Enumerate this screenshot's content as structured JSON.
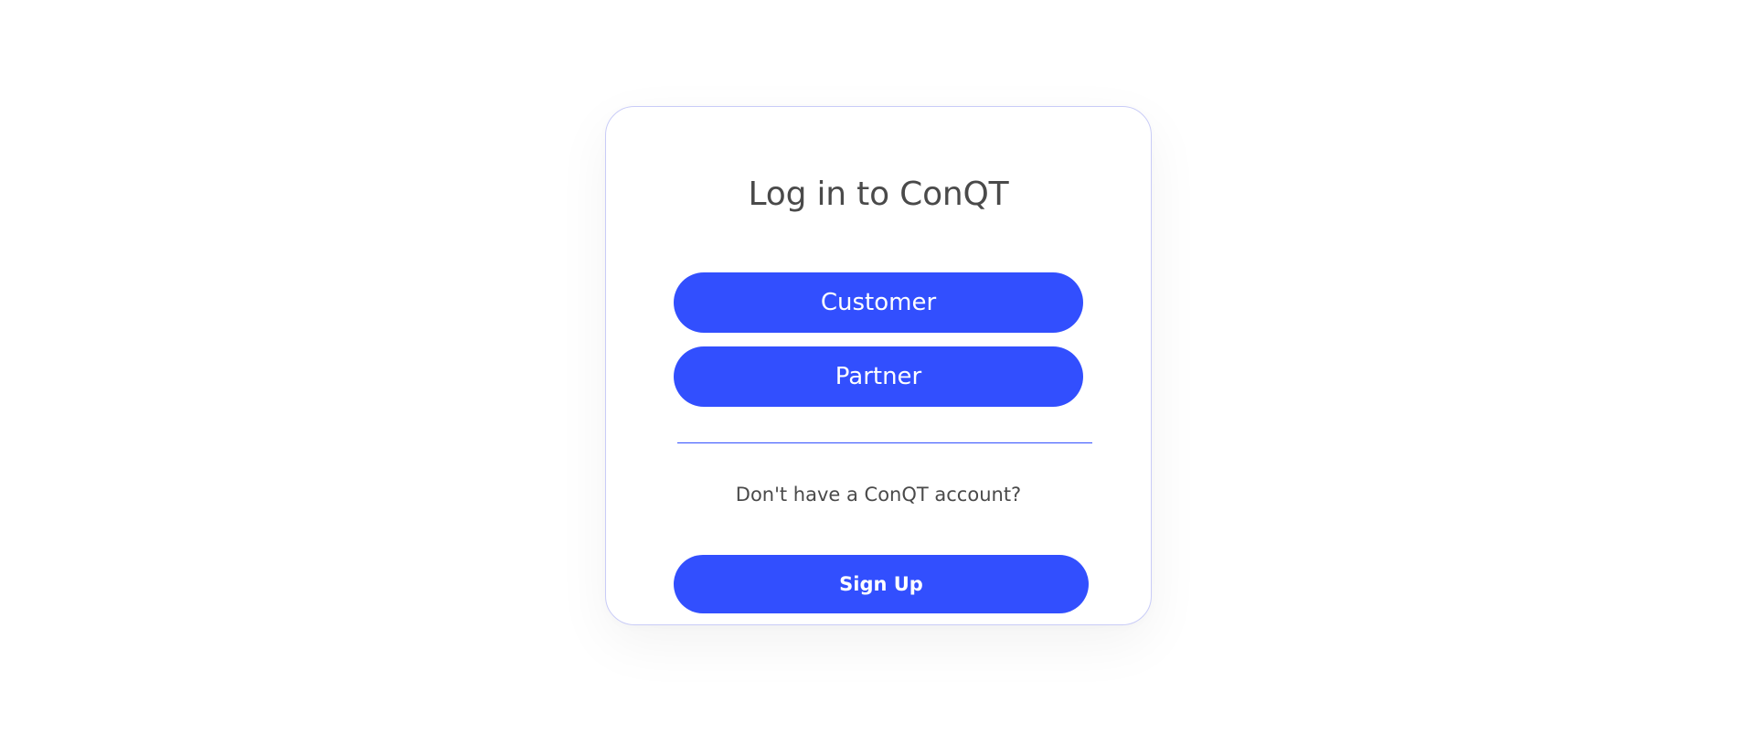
{
  "login_card": {
    "title": "Log in to ConQT",
    "customer_button_label": "Customer",
    "partner_button_label": "Partner",
    "signup_prompt": "Don't have a ConQT account?",
    "signup_button_label": "Sign Up"
  },
  "colors": {
    "accent": "#324ffe",
    "text": "#4a4a4a",
    "card_border": "#c9ccf7",
    "background": "#ffffff"
  }
}
